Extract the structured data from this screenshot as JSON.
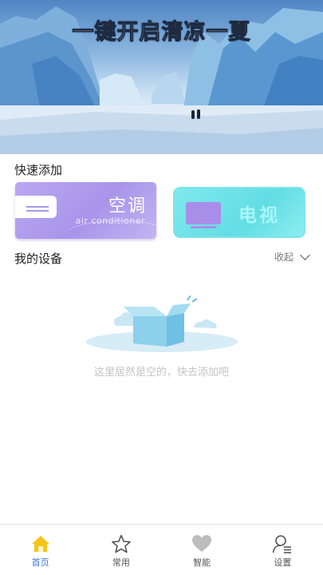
{
  "banner": {
    "title": "一键开启清凉一夏"
  },
  "quick_add": {
    "title": "快速添加",
    "cards": [
      {
        "label": "空调",
        "sub": "air conditioner",
        "icon": "air-conditioner-icon"
      },
      {
        "label": "电视",
        "icon": "tv-icon"
      }
    ]
  },
  "devices": {
    "title": "我的设备",
    "collapse_label": "收起",
    "empty_text": "这里居然是空的，快去添加吧"
  },
  "nav": {
    "items": [
      {
        "label": "首页",
        "icon": "home-icon",
        "active": true
      },
      {
        "label": "常用",
        "icon": "star-icon"
      },
      {
        "label": "智能",
        "icon": "heart-icon"
      },
      {
        "label": "设置",
        "icon": "settings-user-icon"
      }
    ]
  },
  "colors": {
    "accent": "#3b6fd8",
    "home_icon": "#f5c518",
    "ac_card": "#a895ea",
    "tv_card": "#62dde3"
  }
}
